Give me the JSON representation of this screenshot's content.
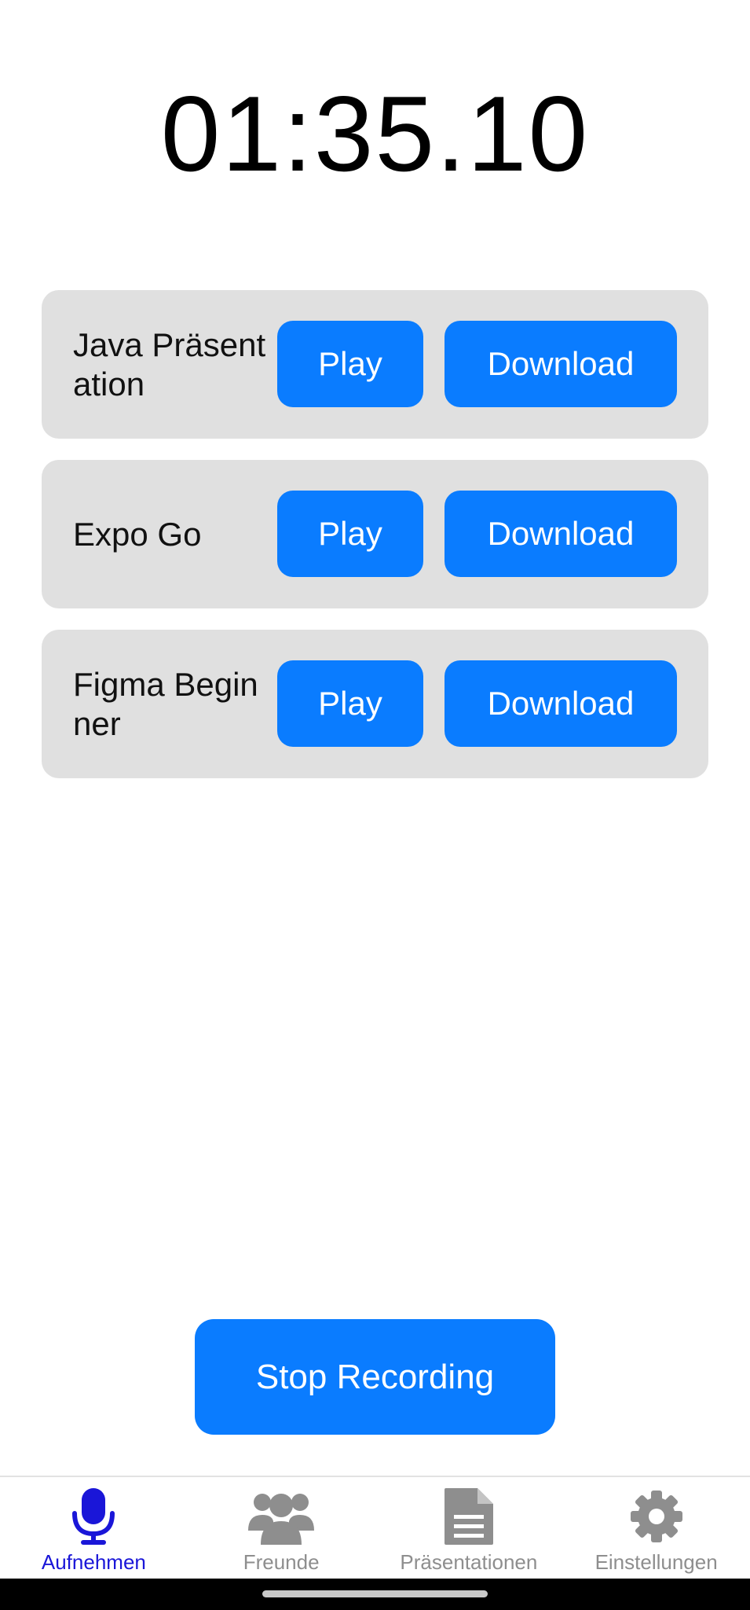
{
  "timer": "01:35.10",
  "recordings": [
    {
      "title": "Java Präsentation",
      "play_label": "Play",
      "download_label": "Download"
    },
    {
      "title": "Expo Go",
      "play_label": "Play",
      "download_label": "Download"
    },
    {
      "title": "Figma Beginner",
      "play_label": "Play",
      "download_label": "Download"
    }
  ],
  "stop_button_label": "Stop Recording",
  "tabs": [
    {
      "label": "Aufnehmen",
      "icon": "microphone-icon",
      "active": true
    },
    {
      "label": "Freunde",
      "icon": "friends-icon",
      "active": false
    },
    {
      "label": "Präsentationen",
      "icon": "document-icon",
      "active": false
    },
    {
      "label": "Einstellungen",
      "icon": "gear-icon",
      "active": false
    }
  ],
  "colors": {
    "accent": "#0a7cff",
    "card_background": "#e0e0e0",
    "active_tab": "#1a16d8",
    "inactive_tab": "#8e8e8e"
  }
}
